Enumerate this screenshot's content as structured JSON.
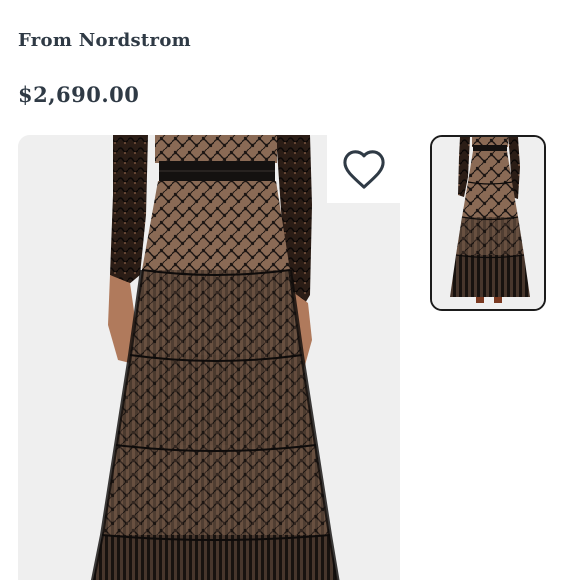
{
  "listing": {
    "retailer_text": "From Nordstrom",
    "price": "$2,690.00"
  },
  "gallery": {
    "main_image_alt": "Lace tiered maxi dress",
    "favorite_icon": "heart-outline-icon",
    "thumbnail_alt": "Lace tiered maxi dress full length",
    "thumbnail_selected": true
  },
  "colors": {
    "text": "#2f3a45",
    "lace_black": "#121010",
    "lining_nude": "#8a6a55",
    "skin": "#b07a5c",
    "background": "#efefef"
  }
}
